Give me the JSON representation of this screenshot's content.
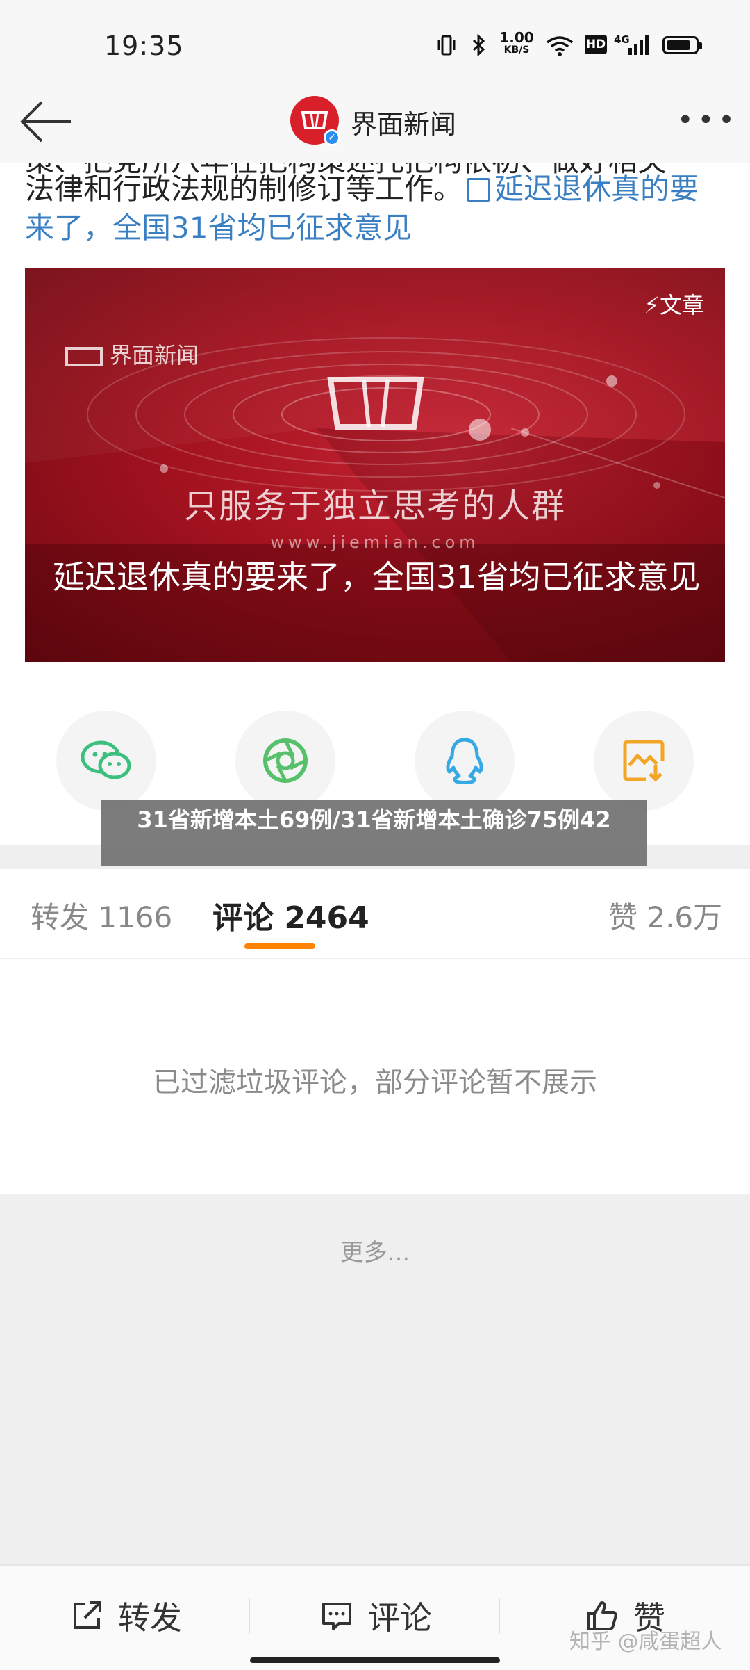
{
  "status_bar": {
    "time": "19:35",
    "network_speed_value": "1.00",
    "network_speed_unit": "KB/S",
    "hd_label": "HD",
    "signal_label": "4G",
    "icons": [
      "vibrate-icon",
      "bluetooth-icon",
      "wifi-icon",
      "signal-icon",
      "battery-icon"
    ],
    "battery_level": 0.85
  },
  "header": {
    "account_name": "界面新闻",
    "verified_mark": "✓",
    "more_label": "•••"
  },
  "article": {
    "cut_text": "策、把党所八年在把构策述托把构依初、做好相关",
    "line_text": "法律和行政法规的制修订等工作。",
    "link_text": "延迟退休真的要来了，全国31省均已征求意见"
  },
  "banner": {
    "watermark_logo": "界面新闻",
    "tag": "⚡文章",
    "slogan": "只服务于独立思考的人群",
    "url": "www.jiemian.com",
    "caption": "延迟退休真的要来了，全国31省均已征求意见"
  },
  "share_targets": [
    {
      "name": "wechat-icon",
      "color": "#3dbf7e"
    },
    {
      "name": "moments-icon",
      "color": "#56c06b"
    },
    {
      "name": "qq-icon",
      "color": "#34a9e6"
    },
    {
      "name": "save-image-icon",
      "color": "#f3a526"
    }
  ],
  "overlay_title": "31省新增本土69例/31省新增本土确诊75例42",
  "tabs": {
    "repost": "转发 1166",
    "comment": "评论 2464",
    "like": "赞 2.6万",
    "active_color": "#ff8200"
  },
  "comments": {
    "filtered_notice": "已过滤垃圾评论，部分评论暂不展示",
    "more": "更多..."
  },
  "bottom_bar": {
    "repost": "转发",
    "comment": "评论",
    "like": "赞"
  },
  "watermark": "知乎 @咸蛋超人"
}
